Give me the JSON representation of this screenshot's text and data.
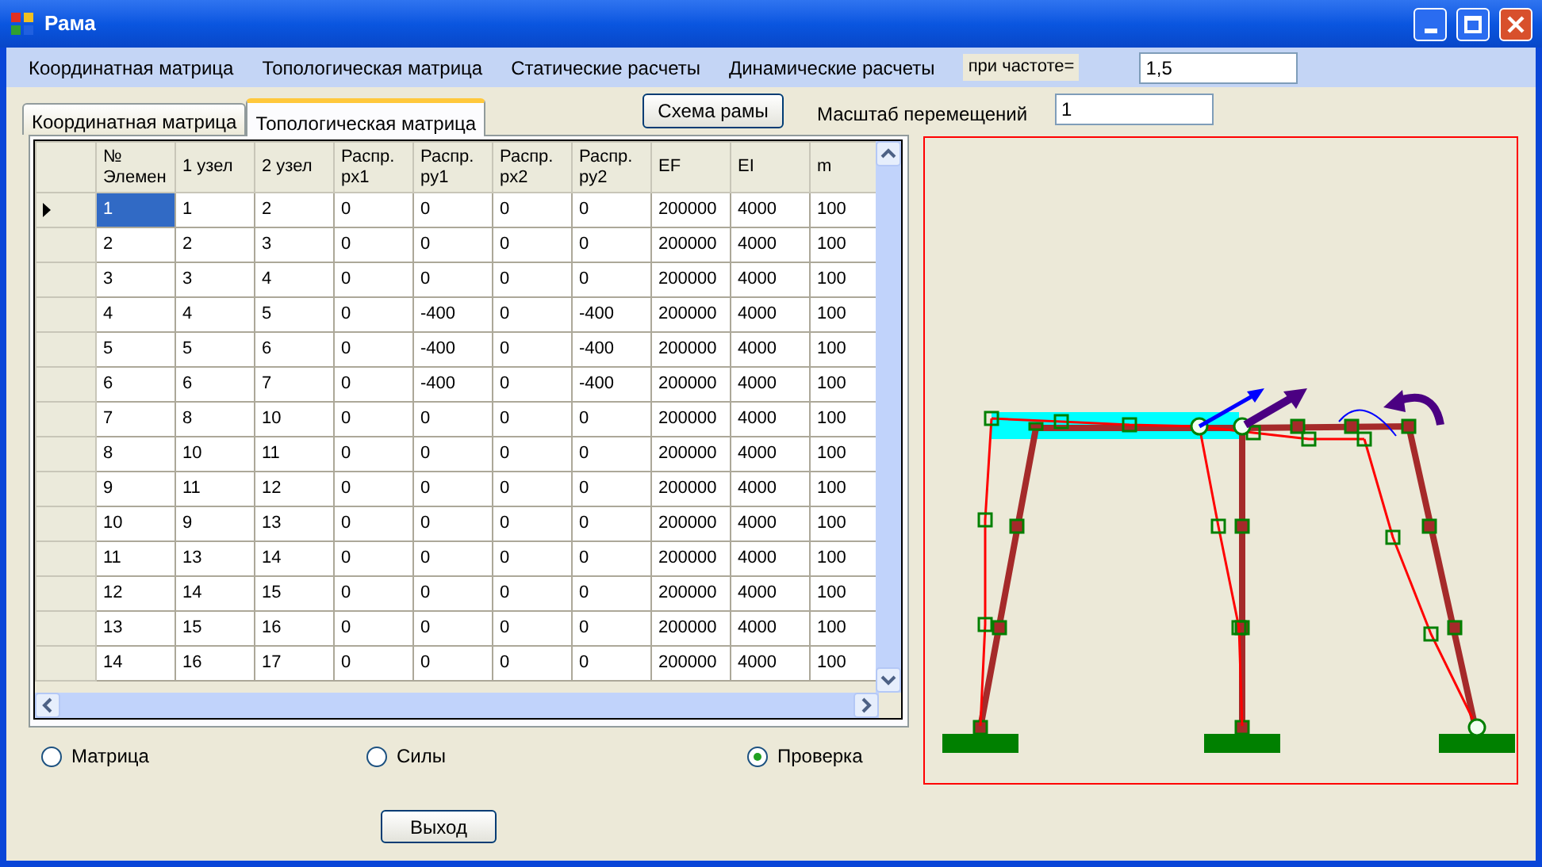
{
  "window": {
    "title": "Рама"
  },
  "menu": [
    "Координатная матрица",
    "Топологическая матрица",
    "Статические расчеты",
    "Динамические расчеты"
  ],
  "frequency": {
    "label": "при частоте=",
    "value": "1,5"
  },
  "tabs": [
    {
      "label": "Координатная матрица",
      "selected": false
    },
    {
      "label": "Топологическая матрица",
      "selected": true
    }
  ],
  "scheme_button": "Схема рамы",
  "scale": {
    "label": "Масштаб перемещений",
    "value": "1"
  },
  "table": {
    "columns": [
      "№ Элемен",
      "1 узел",
      "2 узел",
      "Распр. px1",
      "Распр. py1",
      "Распр. px2",
      "Распр. py2",
      "EF",
      "EI",
      "m"
    ],
    "rows": [
      {
        "selected": true,
        "cells": [
          "1",
          "1",
          "2",
          "0",
          "0",
          "0",
          "0",
          "200000",
          "4000",
          "100"
        ]
      },
      {
        "selected": false,
        "cells": [
          "2",
          "2",
          "3",
          "0",
          "0",
          "0",
          "0",
          "200000",
          "4000",
          "100"
        ]
      },
      {
        "selected": false,
        "cells": [
          "3",
          "3",
          "4",
          "0",
          "0",
          "0",
          "0",
          "200000",
          "4000",
          "100"
        ]
      },
      {
        "selected": false,
        "cells": [
          "4",
          "4",
          "5",
          "0",
          "-400",
          "0",
          "-400",
          "200000",
          "4000",
          "100"
        ]
      },
      {
        "selected": false,
        "cells": [
          "5",
          "5",
          "6",
          "0",
          "-400",
          "0",
          "-400",
          "200000",
          "4000",
          "100"
        ]
      },
      {
        "selected": false,
        "cells": [
          "6",
          "6",
          "7",
          "0",
          "-400",
          "0",
          "-400",
          "200000",
          "4000",
          "100"
        ]
      },
      {
        "selected": false,
        "cells": [
          "7",
          "8",
          "10",
          "0",
          "0",
          "0",
          "0",
          "200000",
          "4000",
          "100"
        ]
      },
      {
        "selected": false,
        "cells": [
          "8",
          "10",
          "11",
          "0",
          "0",
          "0",
          "0",
          "200000",
          "4000",
          "100"
        ]
      },
      {
        "selected": false,
        "cells": [
          "9",
          "11",
          "12",
          "0",
          "0",
          "0",
          "0",
          "200000",
          "4000",
          "100"
        ]
      },
      {
        "selected": false,
        "cells": [
          "10",
          "9",
          "13",
          "0",
          "0",
          "0",
          "0",
          "200000",
          "4000",
          "100"
        ]
      },
      {
        "selected": false,
        "cells": [
          "11",
          "13",
          "14",
          "0",
          "0",
          "0",
          "0",
          "200000",
          "4000",
          "100"
        ]
      },
      {
        "selected": false,
        "cells": [
          "12",
          "14",
          "15",
          "0",
          "0",
          "0",
          "0",
          "200000",
          "4000",
          "100"
        ]
      },
      {
        "selected": false,
        "cells": [
          "13",
          "15",
          "16",
          "0",
          "0",
          "0",
          "0",
          "200000",
          "4000",
          "100"
        ]
      },
      {
        "selected": false,
        "cells": [
          "14",
          "16",
          "17",
          "0",
          "0",
          "0",
          "0",
          "200000",
          "4000",
          "100"
        ]
      }
    ]
  },
  "options": [
    {
      "label": "Матрица",
      "selected": false
    },
    {
      "label": "Силы",
      "selected": false
    },
    {
      "label": "Проверка",
      "selected": true
    }
  ],
  "exit_button": "Выход"
}
